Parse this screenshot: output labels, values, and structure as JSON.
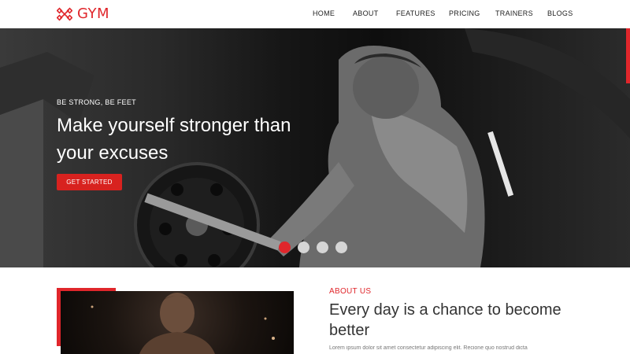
{
  "brand": {
    "name": "GYM",
    "accent": "#e0262b"
  },
  "nav": {
    "items": [
      {
        "label": "HOME"
      },
      {
        "label": "ABOUT"
      },
      {
        "label": "FEATURES"
      },
      {
        "label": "PRICING"
      },
      {
        "label": "TRAINERS"
      },
      {
        "label": "BLOGS"
      }
    ]
  },
  "hero": {
    "tagline": "BE STRONG, BE FEET",
    "title": "Make yourself stronger than your excuses",
    "button_label": "GET STARTED",
    "slides": {
      "count": 4,
      "active": 1
    }
  },
  "about": {
    "label": "ABOUT US",
    "heading": "Every day is a chance to become better",
    "text": "Lorem ipsum dolor sit amet consectetur adipiscing elit. Recione quo nostrud dicta"
  },
  "colors": {
    "accent": "#e0262b",
    "text_dark": "#333333",
    "hero_bg": "#111111"
  }
}
